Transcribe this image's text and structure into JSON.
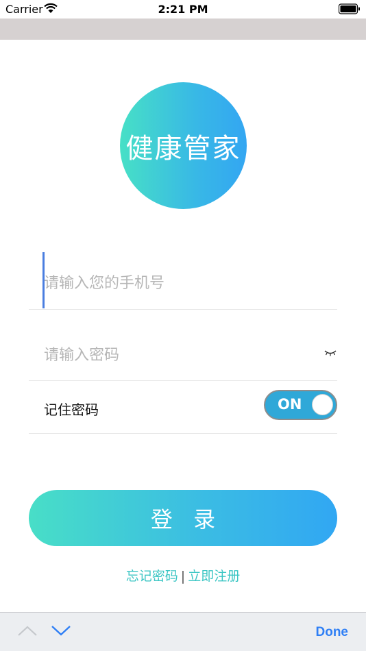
{
  "status_bar": {
    "carrier": "Carrier",
    "time": "2:21 PM"
  },
  "app": {
    "logo_text": "健康管家"
  },
  "form": {
    "phone_placeholder": "请输入您的手机号",
    "password_placeholder": "请输入密码",
    "remember_label": "记住密码",
    "remember_toggle": "ON"
  },
  "actions": {
    "login_label": "登 录",
    "forgot_password": "忘记密码",
    "separator": "|",
    "register": "立即注册"
  },
  "keyboard_toolbar": {
    "done_label": "Done"
  },
  "colors": {
    "accent": "#3cc6c4",
    "gradient_start": "#48dec7",
    "gradient_end": "#31a7f3",
    "done": "#2f7ff5"
  }
}
